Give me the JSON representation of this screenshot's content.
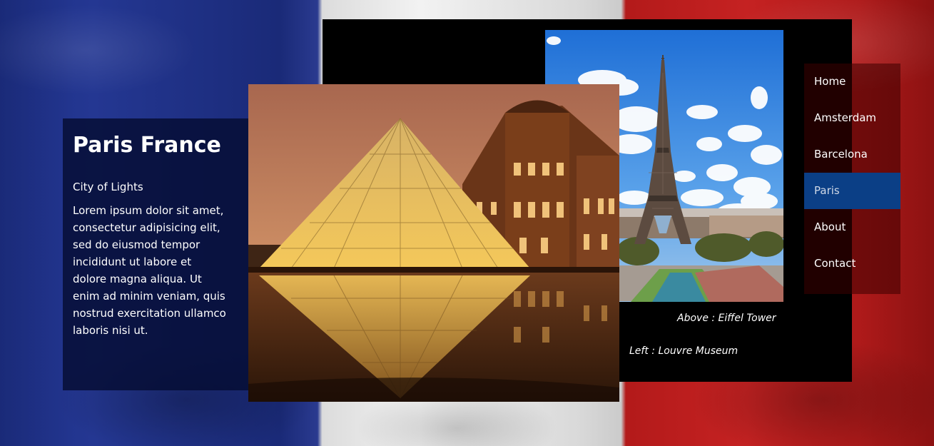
{
  "hero": {
    "title": "Paris France",
    "subtitle": "City of Lights",
    "body": "Lorem ipsum dolor sit amet, consectetur adipisicing elit, sed do eiusmod tempor incididunt ut labore et dolore magna aliqua. Ut enim ad minim veniam, quis nostrud exercitation ullamco laboris nisi ut."
  },
  "nav": {
    "items": [
      {
        "label": "Home"
      },
      {
        "label": "Amsterdam"
      },
      {
        "label": "Barcelona"
      },
      {
        "label": "Paris",
        "active": true
      },
      {
        "label": "About"
      },
      {
        "label": "Contact"
      }
    ]
  },
  "captions": {
    "above": "Above : Eiffel Tower",
    "left": "Left : Louvre Museum"
  },
  "colors": {
    "flag_blue": "#1d2f86",
    "flag_white": "#f2f2f2",
    "flag_red": "#c52222",
    "active_nav": "#0b3f86",
    "panel_dark": "#050c32"
  }
}
